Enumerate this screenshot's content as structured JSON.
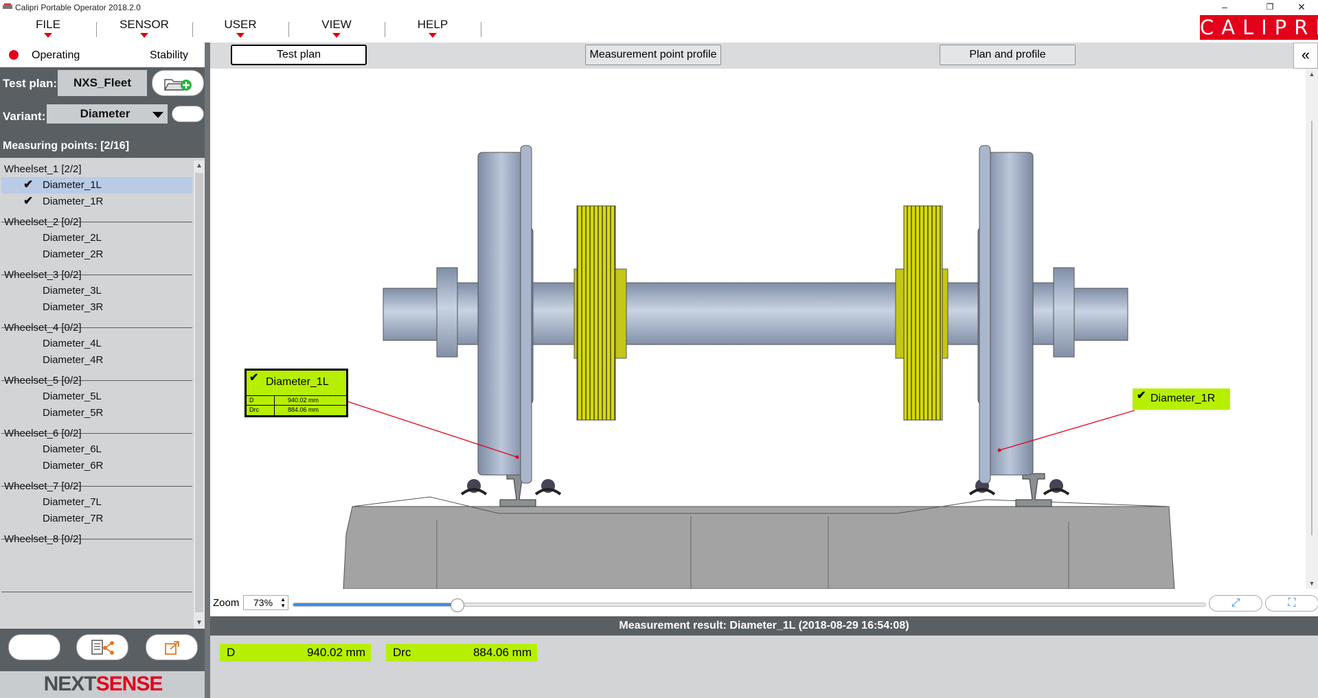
{
  "window": {
    "title": "Calipri Portable Operator 2018.2.0",
    "minimize": "–",
    "restore": "❐",
    "close": "✕"
  },
  "menu": {
    "items": [
      "FILE",
      "SENSOR",
      "USER",
      "VIEW",
      "HELP"
    ]
  },
  "brand": {
    "logo_text": "CALIPRI",
    "color": "#e3001b"
  },
  "status": {
    "operating_label": "Operating",
    "operating_color": "#e3001b",
    "stability_label": "Stability"
  },
  "test_plan": {
    "label": "Test plan:",
    "value": "NXS_Fleet",
    "open_icon": "folder-add-icon"
  },
  "variant": {
    "label": "Variant:",
    "value": "Diameter"
  },
  "measuring_points": {
    "label": "Measuring points: [2/16]"
  },
  "tree": {
    "groups": [
      {
        "title": "Wheelset_1 [2/2]",
        "items": [
          {
            "label": "Diameter_1L",
            "checked": true,
            "selected": true
          },
          {
            "label": "Diameter_1R",
            "checked": true,
            "selected": false
          }
        ]
      },
      {
        "title": "Wheelset_2 [0/2]",
        "items": [
          {
            "label": "Diameter_2L"
          },
          {
            "label": "Diameter_2R"
          }
        ]
      },
      {
        "title": "Wheelset_3 [0/2]",
        "items": [
          {
            "label": "Diameter_3L"
          },
          {
            "label": "Diameter_3R"
          }
        ]
      },
      {
        "title": "Wheelset_4 [0/2]",
        "items": [
          {
            "label": "Diameter_4L"
          },
          {
            "label": "Diameter_4R"
          }
        ]
      },
      {
        "title": "Wheelset_5 [0/2]",
        "items": [
          {
            "label": "Diameter_5L"
          },
          {
            "label": "Diameter_5R"
          }
        ]
      },
      {
        "title": "Wheelset_6 [0/2]",
        "items": [
          {
            "label": "Diameter_6L"
          },
          {
            "label": "Diameter_6R"
          }
        ]
      },
      {
        "title": "Wheelset_7 [0/2]",
        "items": [
          {
            "label": "Diameter_7L"
          },
          {
            "label": "Diameter_7R"
          }
        ]
      },
      {
        "title": "Wheelset_8 [0/2]",
        "items": []
      }
    ]
  },
  "bottom_buttons": {
    "share_icon": "share-document-icon",
    "export_icon": "export-icon"
  },
  "footer_logo": {
    "text_next": "NEXT",
    "text_sense": "SENSE"
  },
  "tabs": {
    "test_plan": "Test plan",
    "measurement_point_profile": "Measurement point profile",
    "plan_and_profile": "Plan and profile",
    "active": "Test plan"
  },
  "collapse": {
    "glyph": "«"
  },
  "callouts": {
    "left": {
      "title": "Diameter_1L",
      "rows": [
        {
          "k": "D",
          "v": "940.02 mm"
        },
        {
          "k": "Drc",
          "v": "884.06 mm"
        }
      ]
    },
    "right": {
      "title": "Diameter_1R"
    }
  },
  "zoom": {
    "label": "Zoom",
    "value": "73%",
    "level": 0.18
  },
  "result": {
    "header": "Measurement result: Diameter_1L (2018-08-29 16:54:08)",
    "values": [
      {
        "k": "D",
        "v": "940.02 mm"
      },
      {
        "k": "Drc",
        "v": "884.06 mm"
      }
    ]
  },
  "colors": {
    "accent_green": "#b7ef00",
    "panel_dark": "#5a5f63",
    "panel_light": "#d2d4d6",
    "selection": "#b9cbe6",
    "zoom_blue": "#3b8fe0"
  }
}
